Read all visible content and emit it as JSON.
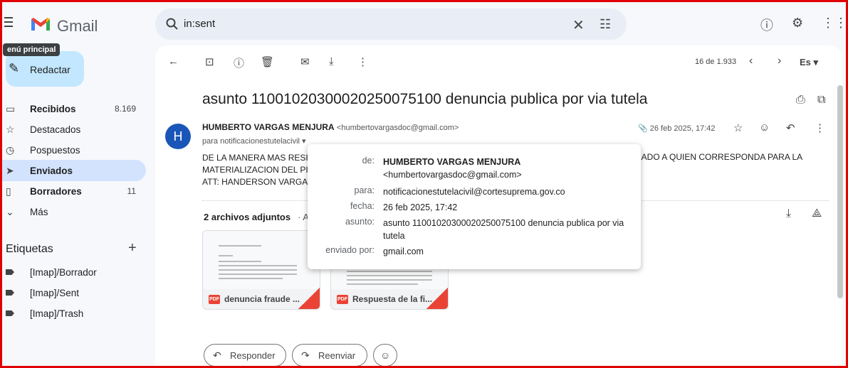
{
  "app": {
    "name": "Gmail"
  },
  "search": {
    "query": "in:sent"
  },
  "sidebar": {
    "tooltip": "enú principal",
    "compose_label": "Redactar",
    "items": [
      {
        "label": "Recibidos",
        "count": "8.169",
        "bold": true
      },
      {
        "label": "Destacados",
        "count": ""
      },
      {
        "label": "Pospuestos",
        "count": ""
      },
      {
        "label": "Enviados",
        "count": "",
        "active": true
      },
      {
        "label": "Borradores",
        "count": "11",
        "bold": true
      },
      {
        "label": "Más",
        "count": ""
      }
    ],
    "labels_title": "Etiquetas",
    "labels": [
      "[Imap]/Borrador",
      "[Imap]/Sent",
      "[Imap]/Trash"
    ]
  },
  "toolbar": {
    "pager": "16 de 1.933",
    "lang": "Es"
  },
  "email": {
    "subject": "asunto 11001020300020250075100 denuncia publica por via tutela",
    "avatar_letter": "H",
    "sender_name": "HUMBERTO VARGAS MENJURA",
    "sender_email": "<humbertovargasdoc@gmail.com>",
    "to_line": "para notificacionestutelacivil",
    "date": "26 feb 2025, 17:42",
    "body_line1": "DE LA MANERA MAS RESI",
    "body_line1_right": "SLADO A QUIEN CORRESPONDA PARA LA",
    "body_line2": "MATERIALIZACION DEL PI",
    "body_line3": "ATT: HANDERSON VARGA"
  },
  "attachments": {
    "title": "2 archivos adjuntos",
    "title_suffix": "· Ar",
    "files": [
      {
        "name": "denuncia fraude ...",
        "type": "PDF"
      },
      {
        "name": "Respuesta de la fi...",
        "type": "PDF"
      }
    ]
  },
  "actions": {
    "reply": "Responder",
    "forward": "Reenviar"
  },
  "popup": {
    "rows": [
      {
        "key": "de:",
        "value": "HUMBERTO VARGAS MENJURA",
        "value2": "<humbertovargasdoc@gmail.com>"
      },
      {
        "key": "para:",
        "value": "notificacionestutelacivil@cortesuprema.gov.co"
      },
      {
        "key": "fecha:",
        "value": "26 feb 2025, 17:42"
      },
      {
        "key": "asunto:",
        "value": "asunto 11001020300020250075100 denuncia publica por via tutela"
      },
      {
        "key": "enviado por:",
        "value": "gmail.com"
      }
    ]
  },
  "colors": {
    "accent": "#c2e7ff",
    "active_nav": "#d3e3fd",
    "avatar": "#1a56b8",
    "frame": "#e00000"
  }
}
